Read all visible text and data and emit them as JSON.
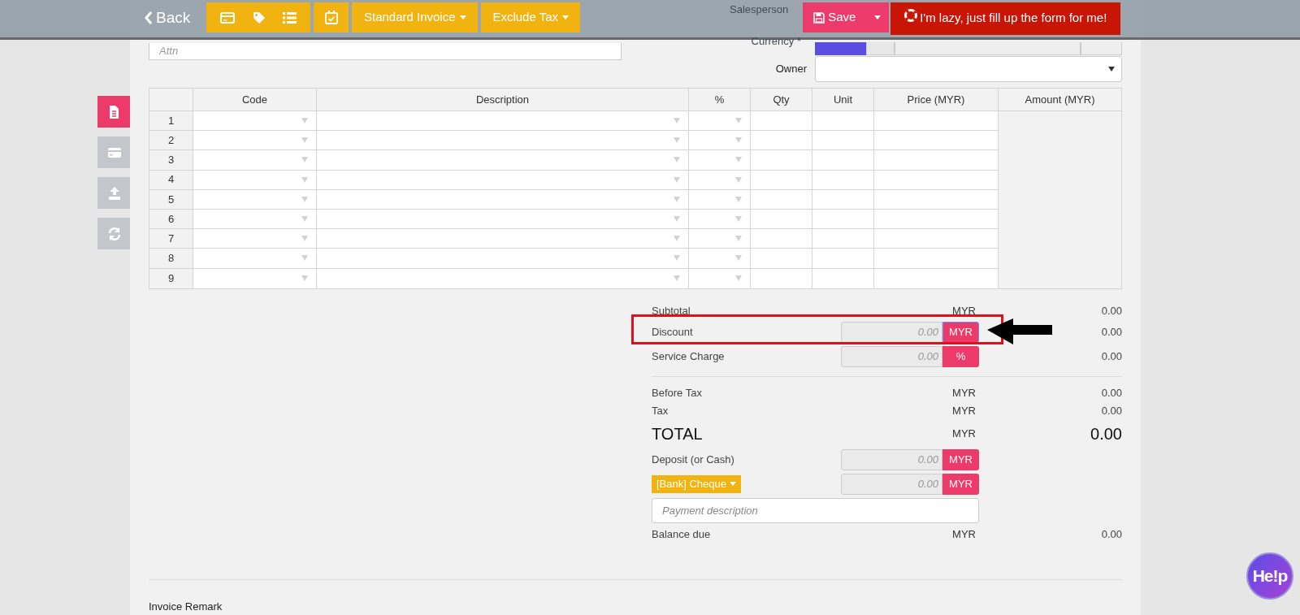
{
  "toolbar": {
    "back": "Back",
    "template_menu": "Standard Invoice",
    "tax_menu": "Exclude Tax",
    "save": "Save",
    "autofill": "I'm lazy, just fill up the form for me!"
  },
  "header": {
    "salesperson_label": "Salesperson",
    "currency_label": "Currency *",
    "attn_placeholder": "Attn",
    "owner_label": "Owner"
  },
  "side_tabs": [
    {
      "kind": "document",
      "selected": true
    },
    {
      "kind": "card",
      "selected": false
    },
    {
      "kind": "upload",
      "selected": false
    },
    {
      "kind": "refresh",
      "selected": false
    }
  ],
  "table": {
    "columns": [
      "Code",
      "Description",
      "%",
      "Qty",
      "Unit",
      "Price (MYR)",
      "Amount (MYR)"
    ],
    "rows": [
      {
        "number": "1"
      },
      {
        "number": "2"
      },
      {
        "number": "3"
      },
      {
        "number": "4"
      },
      {
        "number": "5"
      },
      {
        "number": "6"
      },
      {
        "number": "7"
      },
      {
        "number": "8"
      },
      {
        "number": "9"
      }
    ]
  },
  "totals": [
    {
      "kind": "plain",
      "label": "Subtotal",
      "currency": "MYR",
      "value": "0.00"
    },
    {
      "kind": "input",
      "label": "Discount",
      "placeholder": "0.00",
      "unit": "MYR",
      "value": "0.00",
      "highlighted": true
    },
    {
      "kind": "input",
      "label": "Service Charge",
      "placeholder": "0.00",
      "unit": "%",
      "value": "0.00",
      "highlighted": false
    },
    {
      "kind": "divider"
    },
    {
      "kind": "plain",
      "label": "Before Tax",
      "currency": "MYR",
      "value": "0.00"
    },
    {
      "kind": "plain",
      "label": "Tax",
      "currency": "MYR",
      "value": "0.00"
    },
    {
      "kind": "total",
      "label": "TOTAL",
      "currency": "MYR",
      "value": "0.00"
    },
    {
      "kind": "input",
      "label": "Deposit (or Cash)",
      "placeholder": "0.00",
      "unit": "MYR",
      "highlighted": false
    },
    {
      "kind": "method",
      "label": "[Bank] Cheque",
      "placeholder": "0.00",
      "unit": "MYR"
    },
    {
      "kind": "description",
      "placeholder": "Payment description"
    },
    {
      "kind": "plain",
      "label": "Balance due",
      "currency": "MYR",
      "value": "0.00"
    }
  ],
  "remark_label": "Invoice Remark",
  "help": "He!p"
}
